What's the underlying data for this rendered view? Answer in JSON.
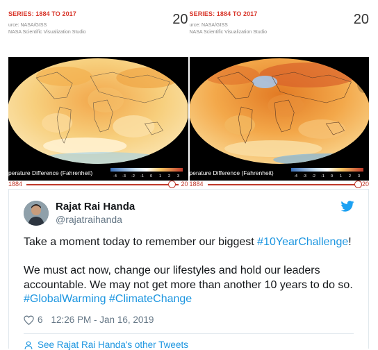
{
  "media": {
    "panels": [
      {
        "series_title": "SERIES: 1884 TO 2017",
        "source_text": "urce: NASA/GISS\nNASA Scientific Visualization Studio",
        "year_big": "20",
        "legend_label": "perature Difference (Fahrenheit)",
        "scale_ticks": [
          "-4",
          "-3",
          "-2",
          "-1",
          "0",
          "1",
          "2",
          "3"
        ],
        "slider_start": "1884",
        "slider_end": "20"
      },
      {
        "series_title": "SERIES: 1884 TO 2017",
        "source_text": "urce: NASA/GISS\nNASA Scientific Visualization Studio",
        "year_big": "20",
        "legend_label": "perature Difference (Fahrenheit)",
        "scale_ticks": [
          "-4",
          "-3",
          "-2",
          "-1",
          "0",
          "1",
          "2",
          "3"
        ],
        "slider_start": "1884",
        "slider_end": "20"
      }
    ]
  },
  "tweet": {
    "author_name": "Rajat Rai Handa",
    "author_handle": "@rajatraihanda",
    "text_line1_prefix": "Take a moment today to remember our biggest ",
    "text_line1_tag": "#10YearChallenge",
    "text_line1_suffix": "!",
    "text_para2": "We must act now, change our lifestyles and hold our leaders accountable. We may not get more than another 10 years to do so. ",
    "tag_global": "#GlobalWarming",
    "tag_climate": "#ClimateChange",
    "likes": "6",
    "timestamp": "12:26 PM - Jan 16, 2019",
    "more_tweets": "See Rajat Rai Handa's other Tweets"
  },
  "colors": {
    "accent": "#1b95e0",
    "series_red": "#d8372b",
    "muted": "#657786"
  },
  "icons": [
    "twitter-bird-icon",
    "heart-icon",
    "person-icon"
  ]
}
